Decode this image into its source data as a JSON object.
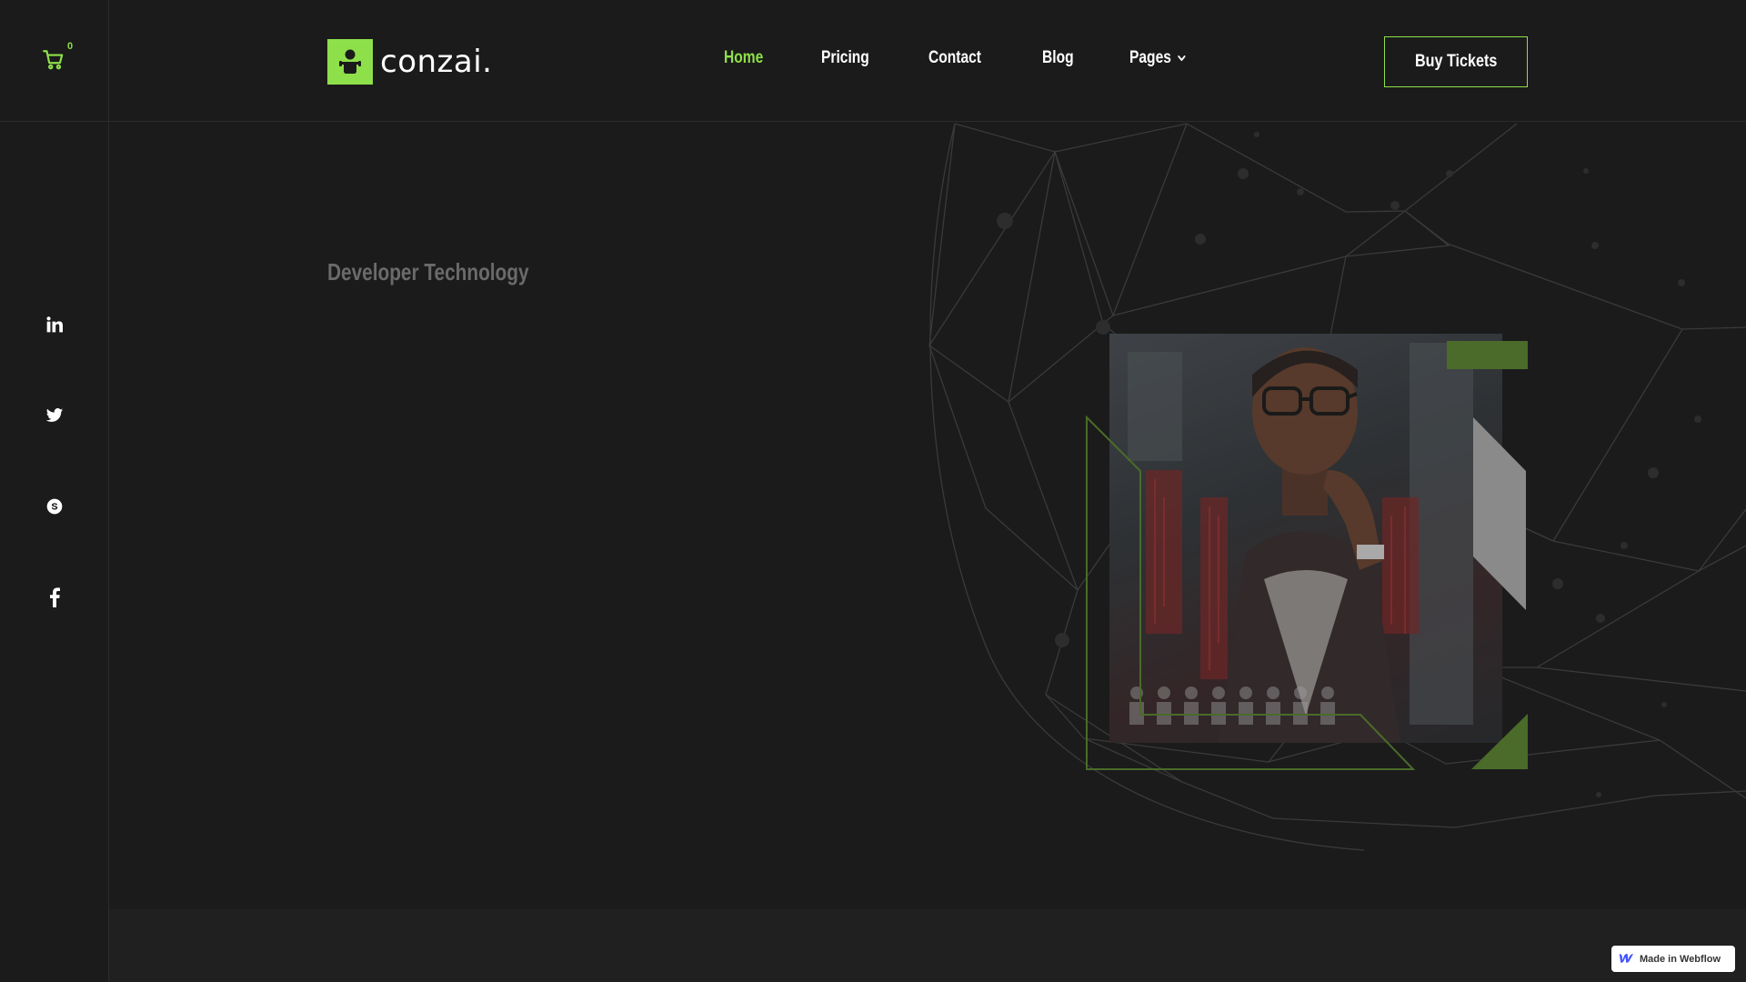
{
  "cart": {
    "count": "0",
    "icon": "cart-icon"
  },
  "socials": [
    {
      "name": "linkedin",
      "icon": "linkedin-icon"
    },
    {
      "name": "twitter",
      "icon": "twitter-icon"
    },
    {
      "name": "skype",
      "icon": "skype-icon"
    },
    {
      "name": "facebook",
      "icon": "facebook-icon"
    }
  ],
  "header": {
    "logo_text": "conzai.",
    "nav": [
      {
        "label": "Home",
        "active": true
      },
      {
        "label": "Pricing",
        "active": false
      },
      {
        "label": "Contact",
        "active": false
      },
      {
        "label": "Blog",
        "active": false
      },
      {
        "label": "Pages",
        "active": false,
        "has_dropdown": true
      }
    ],
    "cta_label": "Buy Tickets"
  },
  "hero": {
    "title": "Developer Technology"
  },
  "badge": {
    "label": "Made in Webflow"
  },
  "colors": {
    "accent": "#8ee04a",
    "dark_accent": "#4a6b2a",
    "background": "#1b1b1b",
    "muted_text": "#6a6a6a"
  }
}
